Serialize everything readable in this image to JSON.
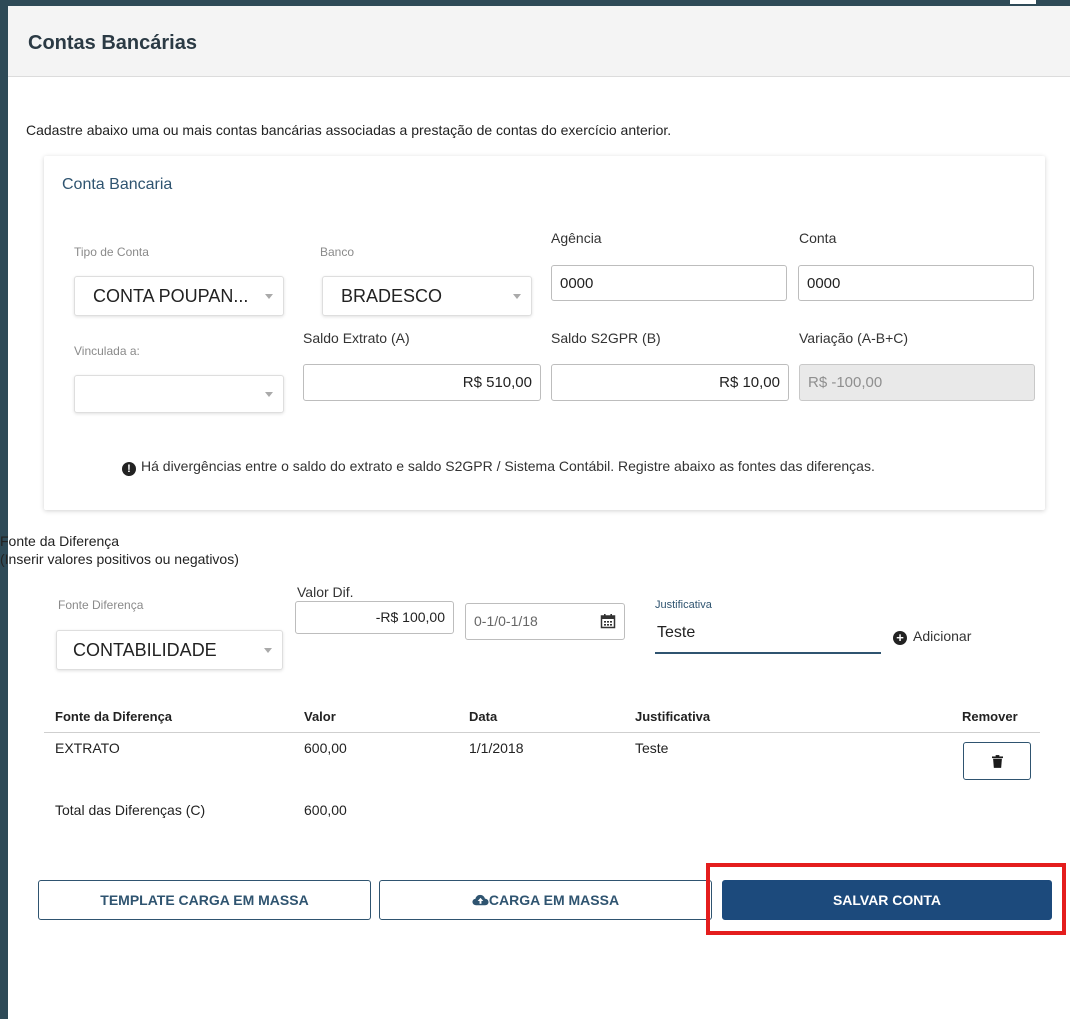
{
  "header": {
    "title": "Contas Bancárias"
  },
  "intro": "Cadastre abaixo uma ou mais contas bancárias associadas a prestação de contas do exercício anterior.",
  "card": {
    "title": "Conta Bancaria",
    "tipo_conta": {
      "label": "Tipo de Conta",
      "value": "CONTA POUPAN..."
    },
    "banco": {
      "label": "Banco",
      "value": "BRADESCO"
    },
    "agencia": {
      "label": "Agência",
      "value": "0000"
    },
    "conta": {
      "label": "Conta",
      "value": "0000"
    },
    "vinculada": {
      "label": "Vinculada a:",
      "value": ""
    },
    "saldo_extrato": {
      "label": "Saldo Extrato (A)",
      "value": "R$ 510,00"
    },
    "saldo_s2gpr": {
      "label": "Saldo S2GPR (B)",
      "value": "R$ 10,00"
    },
    "variacao": {
      "label": "Variação (A-B+C)",
      "value": "R$ -100,00"
    },
    "warning": "Há divergências entre o saldo do extrato e saldo S2GPR / Sistema Contábil. Registre abaixo as fontes das diferenças."
  },
  "fonte": {
    "title": "Fonte da Diferença",
    "subtitle": "(Inserir valores positivos ou negativos)",
    "fonte_diferenca": {
      "label": "Fonte Diferença",
      "value": "CONTABILIDADE"
    },
    "valor_dif": {
      "label": "Valor Dif.",
      "value": "-R$ 100,00"
    },
    "data": {
      "value": "0-1/0-1/18"
    },
    "justificativa": {
      "label": "Justificativa",
      "value": "Teste"
    },
    "add_label": "Adicionar"
  },
  "table": {
    "headers": {
      "fonte": "Fonte da Diferença",
      "valor": "Valor",
      "data": "Data",
      "justificativa": "Justificativa",
      "remover": "Remover"
    },
    "rows": [
      {
        "fonte": "EXTRATO",
        "valor": "600,00",
        "data": "1/1/2018",
        "justificativa": "Teste"
      }
    ],
    "total_label": "Total das Diferenças (C)",
    "total_value": "600,00"
  },
  "buttons": {
    "template": "TEMPLATE CARGA EM MASSA",
    "carga": "CARGA EM MASSA",
    "salvar": "SALVAR CONTA"
  },
  "colors": {
    "accent": "#1c4a7c",
    "highlight": "#e41d1d",
    "sidebar": "#2e4a57"
  },
  "icons": [
    "exclamation-circle-icon",
    "plus-circle-icon",
    "calendar-icon",
    "trash-icon",
    "cloud-upload-icon"
  ]
}
